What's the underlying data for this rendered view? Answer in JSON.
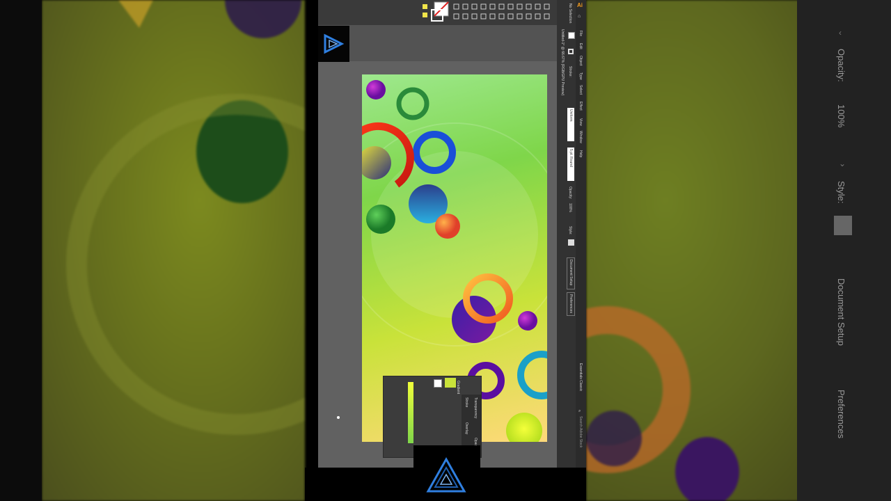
{
  "app": {
    "menu": [
      "File",
      "Edit",
      "Object",
      "Type",
      "Select",
      "Effect",
      "View",
      "Window",
      "Help"
    ],
    "doc_title": "Untitled-1* @ 66.67% (RGB/GPU Preview)",
    "no_selection": "No Selection",
    "stroke_label": "Stroke:",
    "uniform": "Uniform",
    "brush": "5 pt. Round",
    "opacity_label": "Opacity:",
    "opacity_value": "100%",
    "style_label": "Style:",
    "document_setup": "Document Setup",
    "preferences": "Preferences",
    "workspace": "Essentials Classic",
    "search": "Search Adobe Stock"
  },
  "panels": {
    "gradient": "Gradient",
    "stroke": "Stroke",
    "transparency": "Transparency",
    "opacity_label": "Opacity:",
    "overlay": "Overlay"
  },
  "side_right": {
    "opacity_label": "Opacity:",
    "opacity_value": "100%",
    "style_label": "Style:",
    "document_setup": "Document Setup",
    "preferences": "Preferences"
  },
  "colors": {
    "brand_blue": "#2f7fe0",
    "panel_bg": "#3c3c3c",
    "ui_bg": "#535353"
  }
}
